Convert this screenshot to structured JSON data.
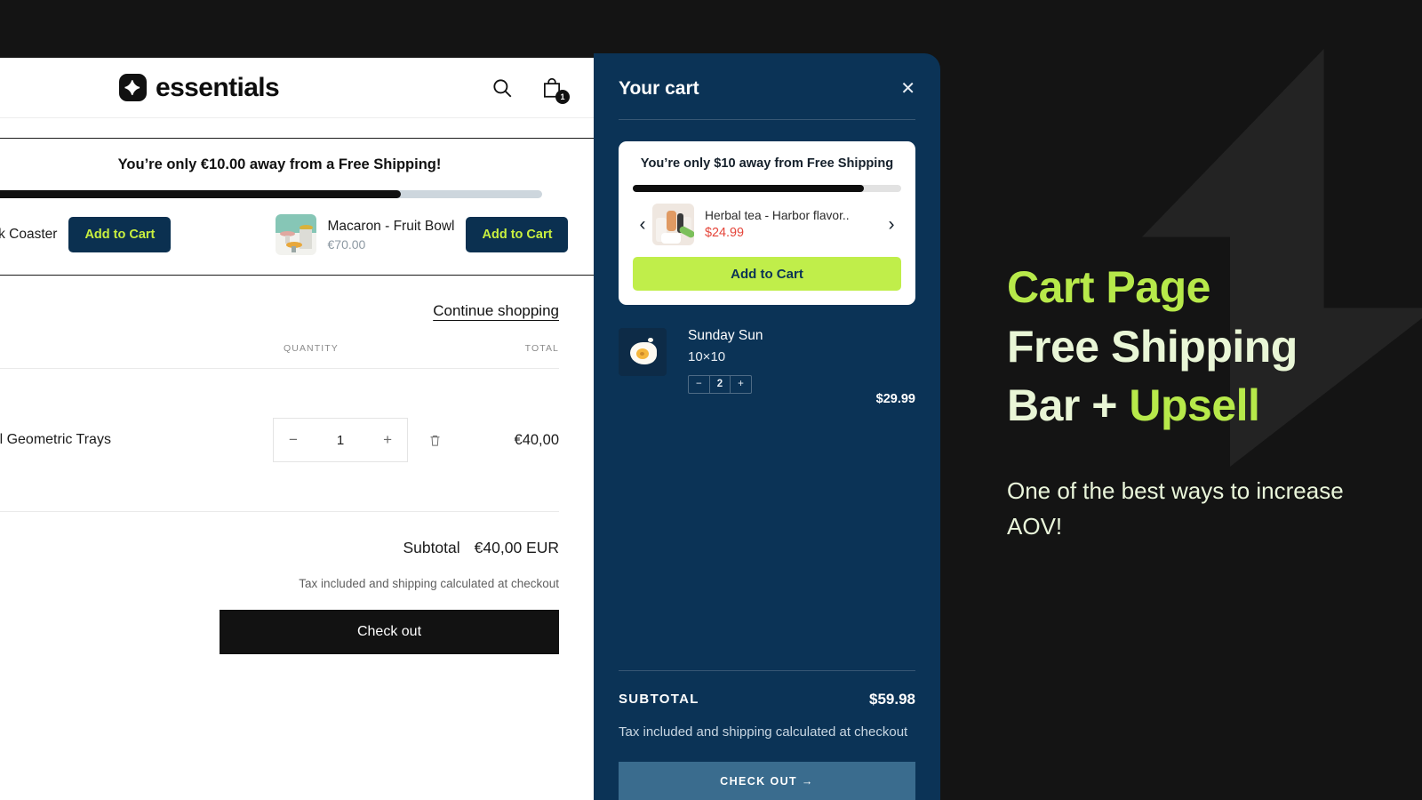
{
  "store": {
    "brand_name": "essentials",
    "brand_logo_icon": "sparkle-icon",
    "search_icon": "search-icon",
    "cart_icon": "shopping-bag-icon",
    "cart_count": "1",
    "shipping_bar": {
      "message": "You’re only €10.00 away from a Free Shipping!",
      "progress_percent": 76,
      "products": [
        {
          "name": "ed Desk Coaster",
          "price": "",
          "button_label": "Add to Cart"
        },
        {
          "name": "Macaron - Fruit Bowl",
          "price": "€70.00",
          "button_label": "Add to Cart"
        }
      ]
    },
    "continue_shopping": "Continue shopping",
    "table_headers": {
      "quantity": "QUANTITY",
      "total": "TOTAL"
    },
    "items": [
      {
        "name": "Colorful Geometric Trays",
        "quantity": "1",
        "decrement": "−",
        "increment": "+",
        "remove_icon": "trash-icon",
        "total": "€40,00"
      }
    ],
    "subtotal_label": "Subtotal",
    "subtotal_value": "€40,00 EUR",
    "tax_note": "Tax included and shipping calculated at checkout",
    "checkout_label": "Check out"
  },
  "drawer": {
    "title": "Your cart",
    "close_icon": "close-icon",
    "upsell": {
      "message": "You’re only $10 away from Free Shipping",
      "progress_percent": 86,
      "prev_icon": "chevron-left-icon",
      "next_icon": "chevron-right-icon",
      "product_name": "Herbal tea - Harbor flavor..",
      "product_price": "$24.99",
      "button_label": "Add to Cart"
    },
    "items": [
      {
        "name": "Sunday Sun",
        "variant": "10×10",
        "decrement": "−",
        "quantity": "2",
        "increment": "+",
        "price": "$29.99"
      }
    ],
    "subtotal_label": "SUBTOTAL",
    "subtotal_value": "$59.98",
    "tax_note": "Tax included and shipping calculated at checkout",
    "checkout_label": "CHECK OUT →"
  },
  "promo": {
    "line1": "Cart Page",
    "line2": "Free Shipping",
    "line3a": "Bar + ",
    "line3b": "Upsell",
    "body": "One of the best ways to increase AOV!"
  },
  "colors": {
    "page_background": "#141414",
    "drawer_background": "#0b3356",
    "accent_lime": "#b7e94a",
    "accent_cream": "#e9f6d6",
    "upsell_button": "#c0ee4a",
    "checkout_button": "#3a6c8e",
    "price_red": "#e4453a"
  }
}
